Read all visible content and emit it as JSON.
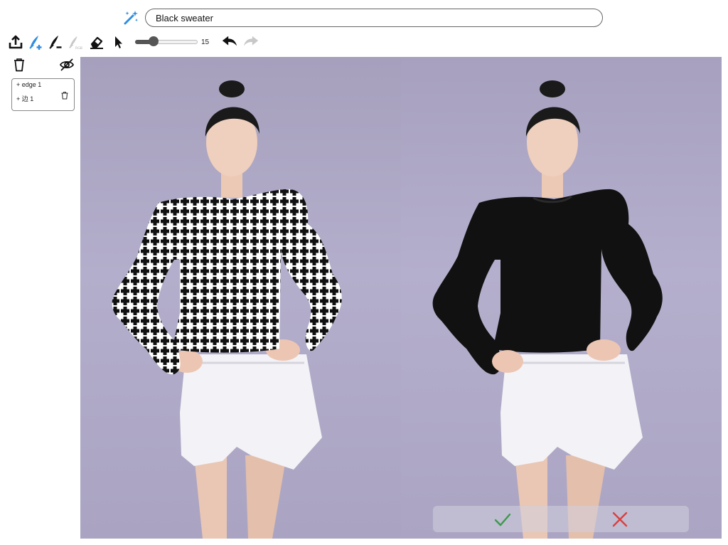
{
  "prompt": {
    "value": "Black sweater",
    "placeholder": "",
    "icon": "magic-wand-icon"
  },
  "toolbar": {
    "tools": [
      "upload-icon",
      "pen-add-icon",
      "pen-remove-icon",
      "pen-rgb-icon",
      "eraser-icon",
      "pointer-icon",
      "undo-icon",
      "redo-icon"
    ],
    "brush_size": "15",
    "brush_fraction": 0.29,
    "accent": "#2f8ee0"
  },
  "panel": {
    "layers": [
      {
        "label": "+ edge 1"
      },
      {
        "label": "+ 边 1"
      }
    ]
  },
  "images": {
    "original_label": "",
    "result_label": "",
    "garment_color": "#111111",
    "background_color": "#aea8c6"
  },
  "confirm": {
    "accept_color": "#3a9a4a",
    "reject_color": "#d84040"
  }
}
